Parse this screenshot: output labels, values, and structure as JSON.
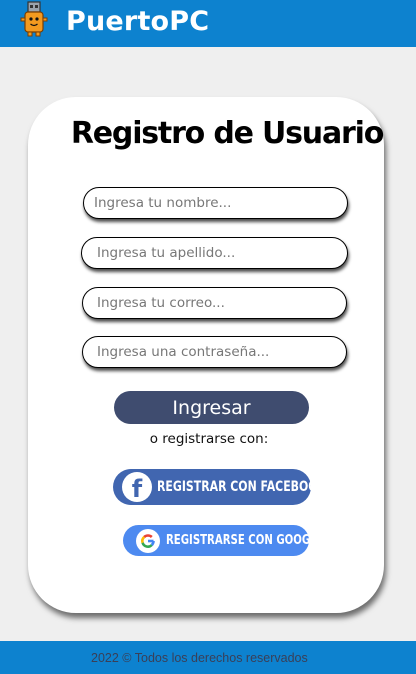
{
  "header": {
    "brand": "PuertoPC",
    "logo_icon": "usb-mascot-icon",
    "bar_color": "#0d82cf"
  },
  "form": {
    "title": "Registro de Usuario",
    "fields": [
      {
        "placeholder": "Ingresa tu nombre...",
        "value": ""
      },
      {
        "placeholder": "Ingresa tu apellido...",
        "value": ""
      },
      {
        "placeholder": "Ingresa tu correo...",
        "value": ""
      },
      {
        "placeholder": "Ingresa una contraseña...",
        "value": ""
      }
    ],
    "submit_label": "Ingresar",
    "or_text": "o registrarse con:"
  },
  "social": {
    "facebook_label": "REGISTRAR CON FACEBOOK",
    "facebook_icon": "facebook-icon",
    "facebook_color": "#4166b0",
    "google_label": "REGISTRARSE CON GOOGLE",
    "google_icon": "google-icon",
    "google_color": "#4d8af0"
  },
  "footer": {
    "text": "2022 © Todos los derechos reservados"
  }
}
